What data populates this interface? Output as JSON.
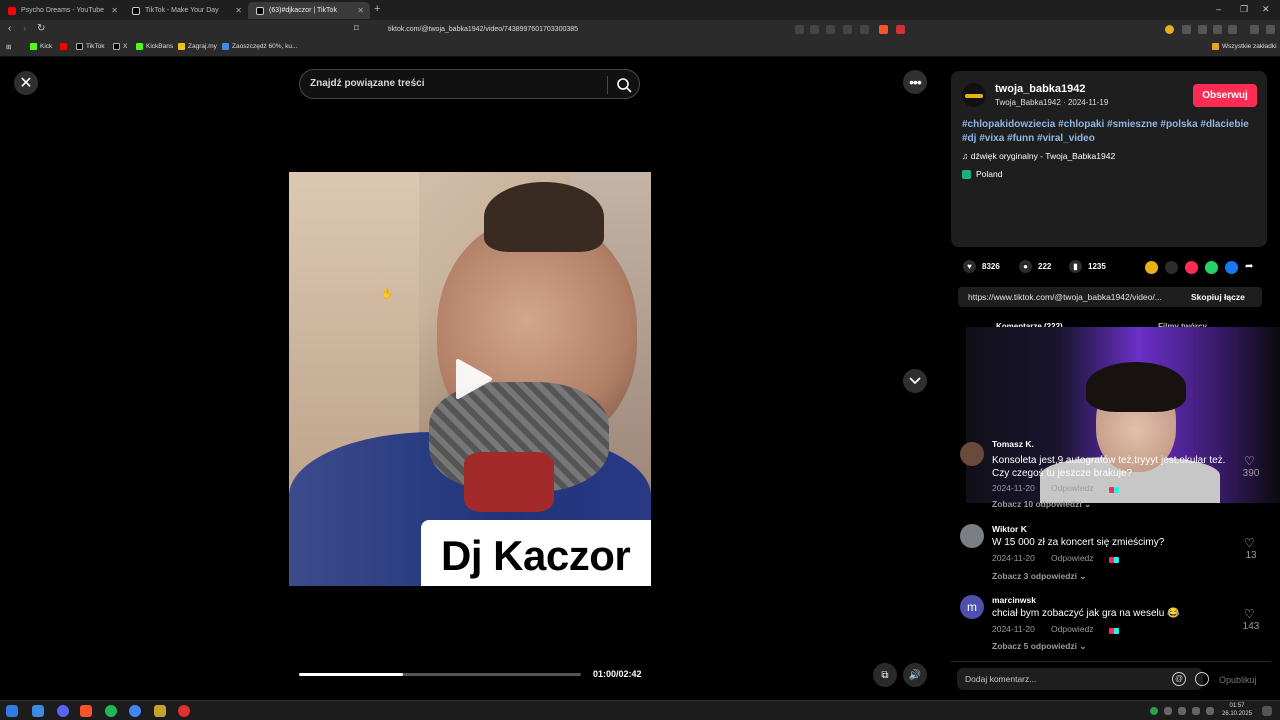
{
  "browser": {
    "tabs": [
      {
        "title": "Psycho Dreams - YouTube",
        "favicon_color": "#ff0000"
      },
      {
        "title": "TikTok - Make Your Day",
        "favicon_color": "#ffffff"
      },
      {
        "title": "(63)#djkaczor | TikTok",
        "favicon_color": "#ffffff",
        "active": true
      }
    ],
    "url": "tiktok.com/@twoja_babka1942/video/7438997601703300385",
    "bookmarks": [
      "Kick",
      "TikTok",
      "X",
      "KickBans",
      "Zagraj.my",
      "Zaoszczędź 60%, ku..."
    ],
    "bookmarks_folder": "Wszystkie zakładki"
  },
  "video": {
    "search_placeholder": "Znajdź powiązane treści",
    "caption": "Dj Kaczor",
    "time": "01:00/02:42",
    "progress_fraction": 0.37
  },
  "post": {
    "username": "twoja_babka1942",
    "subline": "Twoja_Babka1942 · 2024-11-19",
    "follow_label": "Obserwuj",
    "hashtags": "#chlopakidowziecia #chlopaki #smieszne #polska #dlaciebie #dj #vixa #funn #viral_video",
    "sound": "♫  dźwięk oryginalny - Twoja_Babka1942",
    "location": "Poland",
    "likes": "8326",
    "comments_count": "222",
    "saves": "1235",
    "share_url": "https://www.tiktok.com/@twoja_babka1942/video/...",
    "copy_label": "Skopiuj łącze",
    "tab_comments": "Komentarze (222)",
    "tab_creator_videos": "Filmy twórcy"
  },
  "comments": [
    {
      "name": "Tomasz K.",
      "text": "Konsoleta jest,9 autografów też,tryyyt jest,okular też. Czy czegoś tu jeszcze brakuje?",
      "date": "2024-11-20",
      "reply": "Odpowiedz",
      "more": "Zobacz 10 odpowiedzi ⌄",
      "likes": "390",
      "avatar_color": "#6b4a3a"
    },
    {
      "name": "Wiktor K",
      "text": "W 15 000 zł za koncert się zmieścimy?",
      "date": "2024-11-20",
      "reply": "Odpowiedz",
      "more": "Zobacz 3 odpowiedzi ⌄",
      "likes": "13",
      "avatar_color": "#7a7f86"
    },
    {
      "name": "marcinwsk",
      "text": "chciał bym zobaczyć jak gra na weselu 😂",
      "date": "2024-11-20",
      "reply": "Odpowiedz",
      "more": "Zobacz 5 odpowiedzi ⌄",
      "likes": "143",
      "avatar_letter": "m",
      "avatar_color": "#4f4fb0"
    }
  ],
  "comment_bar": {
    "placeholder": "Dodaj komentarz...",
    "post_label": "Opublikuj"
  },
  "taskbar": {
    "time": "01:57",
    "date": "26.10.2025"
  },
  "colors": {
    "accent": "#fe2c55",
    "hashtag": "#8eb8e6"
  }
}
